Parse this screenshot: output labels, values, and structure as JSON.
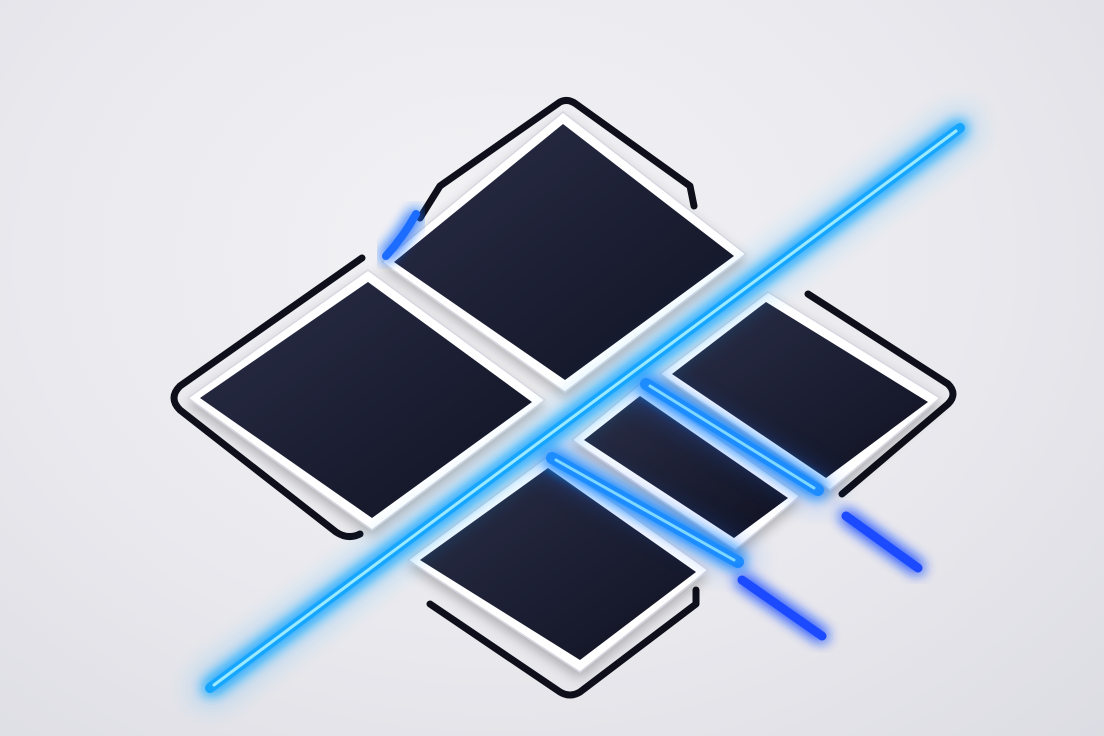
{
  "scene": {
    "subject": "logo-mark",
    "colors": {
      "background": "#ececf0",
      "panel_fill": "#161829",
      "panel_fill_highlight": "#262a44",
      "outline": "#0e0f1a",
      "outline_inner": "#ffffff",
      "glow_primary": "#1aa8ff",
      "glow_secondary": "#1d4cff",
      "glow_core": "#8fe6ff"
    }
  }
}
